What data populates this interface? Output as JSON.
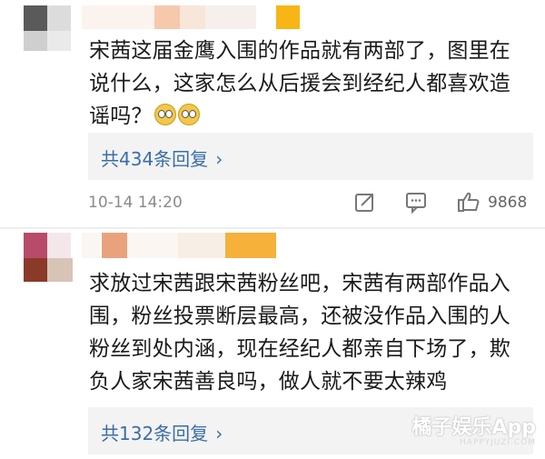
{
  "comments": [
    {
      "text_main": "宋茜这届金鹰入围的作品就有两部了，图里在说什么，这家怎么从后援会到经纪人都喜欢造谣吗？",
      "emoji_names": [
        "eye-roll-emoji",
        "eye-roll-emoji"
      ],
      "reply_label": "共434条回复",
      "time": "10-14 14:20",
      "like_count": "9868"
    },
    {
      "text_main": "求放过宋茜跟宋茜粉丝吧，宋茜有两部作品入围，粉丝投票断层最高，还被没作品入围的人粉丝到处内涵，现在经纪人都亲自下场了，欺负人家宋茜善良吗，做人就不要太辣鸡",
      "reply_label": "共132条回复"
    }
  ],
  "watermark": {
    "main": "橘子娱乐App",
    "sub": "HAPPYJUZI.COM"
  },
  "colors": {
    "link": "#3a6ea8",
    "reply_bg": "#f3f3f3",
    "meta": "#8a8a8a"
  },
  "icons": [
    "share-icon",
    "comment-icon",
    "like-icon",
    "chevron-right-icon"
  ]
}
